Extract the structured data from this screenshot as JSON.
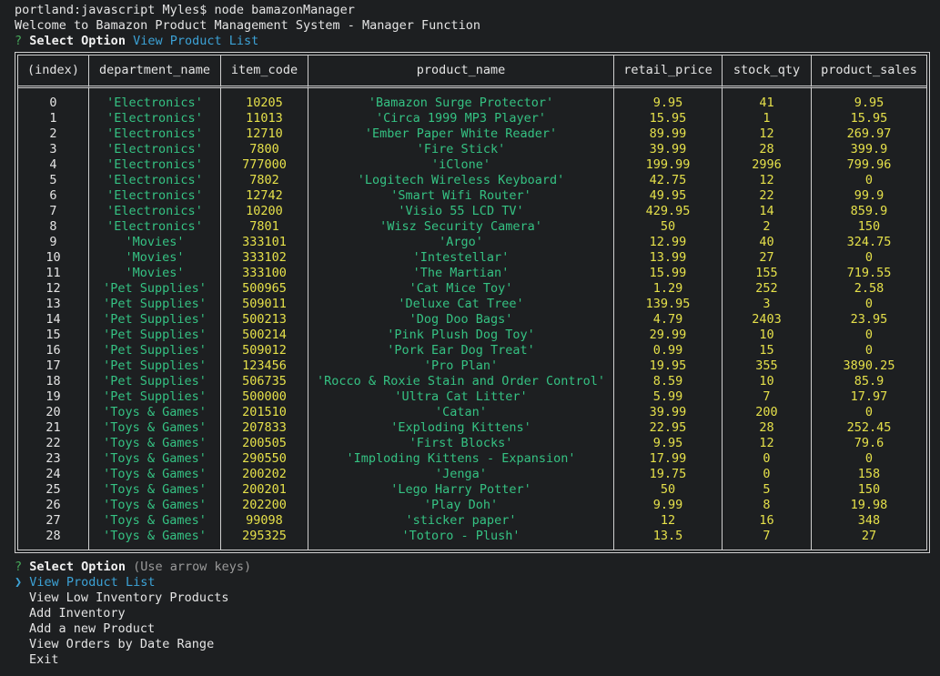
{
  "colors": {
    "background": "#1d1f21",
    "string_green": "#35c283",
    "number_yellow": "#e5e04a",
    "answer_blue": "#3ca2d6"
  },
  "prompt_line": "portland:javascript Myles$ node bamazonManager",
  "welcome_line": "Welcome to Bamazon Product Management System - Manager Function",
  "first_question": {
    "mark": "?",
    "label": "Select Option",
    "answer": "View Product List"
  },
  "table": {
    "headers": [
      "(index)",
      "department_name",
      "item_code",
      "product_name",
      "retail_price",
      "stock_qty",
      "product_sales"
    ],
    "rows": [
      [
        "0",
        "'Electronics'",
        "10205",
        "'Bamazon Surge Protector'",
        "9.95",
        "41",
        "9.95"
      ],
      [
        "1",
        "'Electronics'",
        "11013",
        "'Circa 1999 MP3 Player'",
        "15.95",
        "1",
        "15.95"
      ],
      [
        "2",
        "'Electronics'",
        "12710",
        "'Ember Paper White Reader'",
        "89.99",
        "12",
        "269.97"
      ],
      [
        "3",
        "'Electronics'",
        "7800",
        "'Fire Stick'",
        "39.99",
        "28",
        "399.9"
      ],
      [
        "4",
        "'Electronics'",
        "777000",
        "'iClone'",
        "199.99",
        "2996",
        "799.96"
      ],
      [
        "5",
        "'Electronics'",
        "7802",
        "'Logitech Wireless Keyboard'",
        "42.75",
        "12",
        "0"
      ],
      [
        "6",
        "'Electronics'",
        "12742",
        "'Smart Wifi Router'",
        "49.95",
        "22",
        "99.9"
      ],
      [
        "7",
        "'Electronics'",
        "10200",
        "'Visio 55 LCD TV'",
        "429.95",
        "14",
        "859.9"
      ],
      [
        "8",
        "'Electronics'",
        "7801",
        "'Wisz Security Camera'",
        "50",
        "2",
        "150"
      ],
      [
        "9",
        "'Movies'",
        "333101",
        "'Argo'",
        "12.99",
        "40",
        "324.75"
      ],
      [
        "10",
        "'Movies'",
        "333102",
        "'Intestellar'",
        "13.99",
        "27",
        "0"
      ],
      [
        "11",
        "'Movies'",
        "333100",
        "'The Martian'",
        "15.99",
        "155",
        "719.55"
      ],
      [
        "12",
        "'Pet Supplies'",
        "500965",
        "'Cat Mice Toy'",
        "1.29",
        "252",
        "2.58"
      ],
      [
        "13",
        "'Pet Supplies'",
        "509011",
        "'Deluxe Cat Tree'",
        "139.95",
        "3",
        "0"
      ],
      [
        "14",
        "'Pet Supplies'",
        "500213",
        "'Dog Doo Bags'",
        "4.79",
        "2403",
        "23.95"
      ],
      [
        "15",
        "'Pet Supplies'",
        "500214",
        "'Pink Plush Dog Toy'",
        "29.99",
        "10",
        "0"
      ],
      [
        "16",
        "'Pet Supplies'",
        "509012",
        "'Pork Ear Dog Treat'",
        "0.99",
        "15",
        "0"
      ],
      [
        "17",
        "'Pet Supplies'",
        "123456",
        "'Pro Plan'",
        "19.95",
        "355",
        "3890.25"
      ],
      [
        "18",
        "'Pet Supplies'",
        "506735",
        "'Rocco & Roxie Stain and Order Control'",
        "8.59",
        "10",
        "85.9"
      ],
      [
        "19",
        "'Pet Supplies'",
        "500000",
        "'Ultra Cat Litter'",
        "5.99",
        "7",
        "17.97"
      ],
      [
        "20",
        "'Toys & Games'",
        "201510",
        "'Catan'",
        "39.99",
        "200",
        "0"
      ],
      [
        "21",
        "'Toys & Games'",
        "207833",
        "'Exploding Kittens'",
        "22.95",
        "28",
        "252.45"
      ],
      [
        "22",
        "'Toys & Games'",
        "200505",
        "'First Blocks'",
        "9.95",
        "12",
        "79.6"
      ],
      [
        "23",
        "'Toys & Games'",
        "290550",
        "'Imploding Kittens - Expansion'",
        "17.99",
        "0",
        "0"
      ],
      [
        "24",
        "'Toys & Games'",
        "200202",
        "'Jenga'",
        "19.75",
        "0",
        "158"
      ],
      [
        "25",
        "'Toys & Games'",
        "200201",
        "'Lego Harry Potter'",
        "50",
        "5",
        "150"
      ],
      [
        "26",
        "'Toys & Games'",
        "202200",
        "'Play Doh'",
        "9.99",
        "8",
        "19.98"
      ],
      [
        "27",
        "'Toys & Games'",
        "99098",
        "'sticker paper'",
        "12",
        "16",
        "348"
      ],
      [
        "28",
        "'Toys & Games'",
        "295325",
        "'Totoro - Plush'",
        "13.5",
        "7",
        "27"
      ]
    ]
  },
  "second_question": {
    "mark": "?",
    "label": "Select Option",
    "hint": "(Use arrow keys)"
  },
  "menu": {
    "pointer": "❯",
    "items": [
      "View Product List",
      "View Low Inventory Products",
      "Add Inventory",
      "Add a new Product",
      "View Orders by Date Range",
      "Exit"
    ]
  }
}
